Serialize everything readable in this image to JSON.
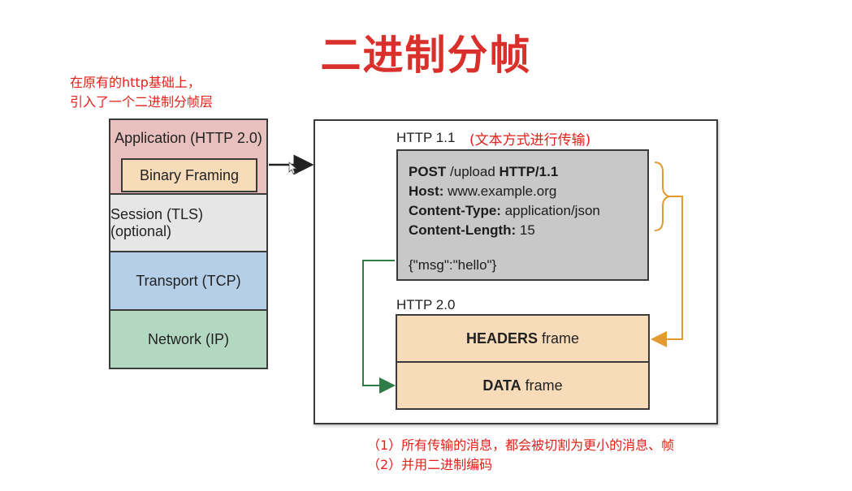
{
  "title": "二进制分帧",
  "note_top": [
    "在原有的http基础上，",
    "引入了一个二进制分帧层"
  ],
  "stack": {
    "application": "Application (HTTP 2.0)",
    "binary_framing": "Binary Framing",
    "session": "Session (TLS) (optional)",
    "transport": "Transport (TCP)",
    "network": "Network (IP)"
  },
  "http11": {
    "label": "HTTP 1.1",
    "annotation": "(文本方式进行传输)",
    "request": [
      {
        "key": "POST",
        "value": " /upload ",
        "key2": "HTTP/1.1"
      },
      {
        "key": "Host:",
        "value": " www.example.org"
      },
      {
        "key": "Content-Type:",
        "value": " application/json"
      },
      {
        "key": "Content-Length:",
        "value": " 15"
      }
    ],
    "body": "{\"msg\":\"hello\"}"
  },
  "http2": {
    "label": "HTTP 2.0",
    "headers_bold": "HEADERS",
    "headers_rest": " frame",
    "data_bold": "DATA",
    "data_rest": " frame"
  },
  "notes_bottom": [
    "（1）所有传输的消息，都会被切割为更小的消息、帧",
    "（2）并用二进制编码"
  ],
  "colors": {
    "application": "#e8c0bd",
    "binary_framing": "#f8dcba",
    "session": "#e6e6e6",
    "transport": "#b5cfe8",
    "network": "#b3d8c2",
    "http11_box": "#c8c8c8",
    "frame": "#f8dcba",
    "orange_arrow": "#e39a32",
    "green_arrow": "#2e7d46",
    "red_text": "#e0221b"
  }
}
